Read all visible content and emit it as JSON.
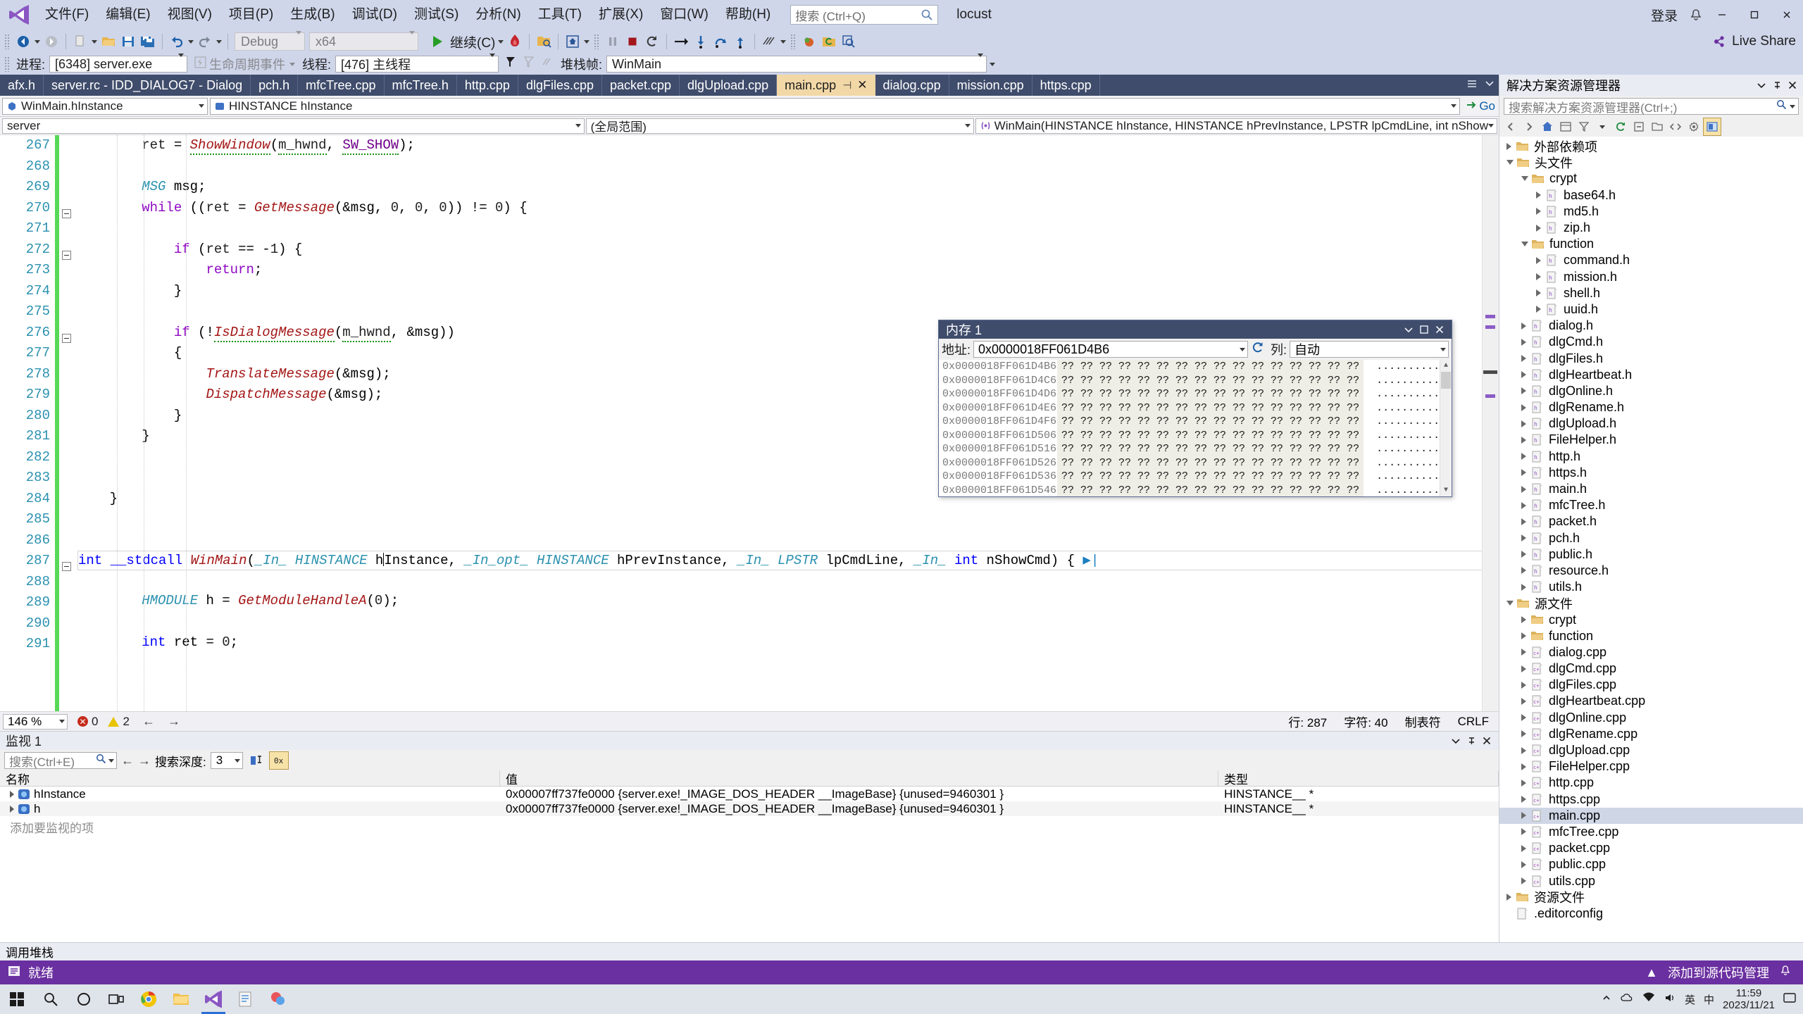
{
  "menubar": {
    "items": [
      "文件(F)",
      "编辑(E)",
      "视图(V)",
      "项目(P)",
      "生成(B)",
      "调试(D)",
      "测试(S)",
      "分析(N)",
      "工具(T)",
      "扩展(X)",
      "窗口(W)",
      "帮助(H)"
    ],
    "search_placeholder": "搜索 (Ctrl+Q)",
    "project_name": "locust",
    "signin_label": "登录",
    "minimize": "—",
    "maximize": "▢",
    "close": "✕"
  },
  "toolbar": {
    "nav_back": "back-arrow",
    "nav_forward": "forward-arrow",
    "new_item": "new-item",
    "open_file": "open-file",
    "save": "save",
    "save_all": "save-all",
    "undo": "undo",
    "redo": "redo",
    "config": "Debug",
    "platform": "x64",
    "continue_label": "继续(C)",
    "hotreload": "hot-reload",
    "attach": "attach-to-process",
    "stop_label": "stop",
    "restart_label": "restart",
    "step_over": "step-over",
    "step_into": "step-into",
    "step_out": "step-out",
    "live_share": "Live Share"
  },
  "debugbar": {
    "process_label": "进程:",
    "process_value": "[6348] server.exe",
    "lifecycle_label": "生命周期事件",
    "thread_label": "线程:",
    "thread_value": "[476] 主线程",
    "stackframe_label": "堆栈帧:",
    "stackframe_value": "WinMain"
  },
  "tabs": {
    "items": [
      {
        "label": "afx.h",
        "active": false
      },
      {
        "label": "server.rc - IDD_DIALOG7 - Dialog",
        "active": false
      },
      {
        "label": "pch.h",
        "active": false
      },
      {
        "label": "mfcTree.cpp",
        "active": false
      },
      {
        "label": "mfcTree.h",
        "active": false
      },
      {
        "label": "http.cpp",
        "active": false
      },
      {
        "label": "dlgFiles.cpp",
        "active": false
      },
      {
        "label": "packet.cpp",
        "active": false
      },
      {
        "label": "dlgUpload.cpp",
        "active": false
      },
      {
        "label": "main.cpp",
        "active": true
      },
      {
        "label": "dialog.cpp",
        "active": false
      },
      {
        "label": "mission.cpp",
        "active": false
      },
      {
        "label": "https.cpp",
        "active": false
      }
    ],
    "pin_glyph": "⊣",
    "close_glyph": "✕"
  },
  "navbar": {
    "class_value": "WinMain.hInstance",
    "member_value": "HINSTANCE hInstance",
    "go_label": "Go"
  },
  "scopebar": {
    "project_value": "server",
    "scope_value": "(全局范围)",
    "function_value": "WinMain(HINSTANCE hInstance, HINSTANCE hPrevInstance, LPSTR lpCmdLine, int nShow"
  },
  "editor": {
    "first_line": 267,
    "lines": [
      {
        "n": 267,
        "html": "        <i>ret</i> = <f u>ShowWindow</f>(<i u>m_hwnd</i>, <m u>SW_SHOW</m>);",
        "fold": false
      },
      {
        "n": 268,
        "html": "",
        "fold": false
      },
      {
        "n": 269,
        "html": "        <t>MSG</t> msg;",
        "fold": false
      },
      {
        "n": 270,
        "html": "        <c>while</c> ((<i>ret</i> = <f>GetMessage</f>(&amp;msg, <n>0</n>, <n>0</n>, <n>0</n>)) != <n>0</n>) {",
        "fold": true
      },
      {
        "n": 271,
        "html": "",
        "fold": false
      },
      {
        "n": 272,
        "html": "            <c>if</c> (<i>ret</i> == -<n>1</n>) {",
        "fold": true
      },
      {
        "n": 273,
        "html": "                <c>return</c>;",
        "fold": false
      },
      {
        "n": 274,
        "html": "            }",
        "fold": false
      },
      {
        "n": 275,
        "html": "",
        "fold": false
      },
      {
        "n": 276,
        "html": "            <c>if</c> (!<f u>IsDialogMessage</f>(<i u>m_hwnd</i>, &amp;msg))",
        "fold": true
      },
      {
        "n": 277,
        "html": "            {",
        "fold": false
      },
      {
        "n": 278,
        "html": "                <f>TranslateMessage</f>(&amp;msg);",
        "fold": false
      },
      {
        "n": 279,
        "html": "                <f>DispatchMessage</f>(&amp;msg);",
        "fold": false
      },
      {
        "n": 280,
        "html": "            }",
        "fold": false
      },
      {
        "n": 281,
        "html": "        }",
        "fold": false
      },
      {
        "n": 282,
        "html": "",
        "fold": false
      },
      {
        "n": 283,
        "html": "",
        "fold": false
      },
      {
        "n": 284,
        "html": "    }",
        "fold": false
      },
      {
        "n": 285,
        "html": "",
        "fold": false
      },
      {
        "n": 286,
        "html": "",
        "fold": false
      },
      {
        "n": 287,
        "html": "CURRENT",
        "fold": true
      },
      {
        "n": 288,
        "html": "",
        "fold": false
      },
      {
        "n": 289,
        "html": "        <t>HMODULE</t> h = <f>GetModuleHandleA</f>(<n>0</n>);",
        "fold": false
      },
      {
        "n": 290,
        "html": "",
        "fold": false
      },
      {
        "n": 291,
        "html": "        <k>int</k> ret = <n>0</n>;",
        "fold": false
      }
    ],
    "current_line_text": "int __stdcall WinMain(_In_ HINSTANCE hInstance, _In_opt_ HINSTANCE hPrevInstance, _In_ LPSTR lpCmdLine, _In_ int nShowCmd) {"
  },
  "editstatus": {
    "zoom": "146 %",
    "error_count": "0",
    "warning_count": "2",
    "line_label": "行: 287",
    "col_label": "字符: 40",
    "insert_label": "制表符",
    "eol_label": "CRLF"
  },
  "memory_window": {
    "title": "内存 1",
    "address_label": "地址:",
    "address_value": "0x0000018FF061D4B6",
    "refresh_icon": "refresh-icon",
    "columns_label": "列:",
    "columns_value": "自动",
    "hex_pattern": "?? ?? ?? ?? ?? ?? ?? ?? ?? ?? ?? ?? ?? ?? ?? ??",
    "ascii_pattern": "................",
    "rows": [
      "0x0000018FF061D4B6",
      "0x0000018FF061D4C6",
      "0x0000018FF061D4D6",
      "0x0000018FF061D4E6",
      "0x0000018FF061D4F6",
      "0x0000018FF061D506",
      "0x0000018FF061D516",
      "0x0000018FF061D526",
      "0x0000018FF061D536",
      "0x0000018FF061D546"
    ]
  },
  "watch_window": {
    "title": "监视 1",
    "search_placeholder": "搜索(Ctrl+E)",
    "depth_label": "搜索深度:",
    "depth_value": "3",
    "columns": [
      "名称",
      "值",
      "类型"
    ],
    "rows": [
      {
        "name": "hInstance",
        "value": "0x00007ff737fe0000 {server.exe!_IMAGE_DOS_HEADER __ImageBase} {unused=9460301 }",
        "type": "HINSTANCE__ *"
      },
      {
        "name": "h",
        "value": "0x00007ff737fe0000 {server.exe!_IMAGE_DOS_HEADER __ImageBase} {unused=9460301 }",
        "type": "HINSTANCE__ *"
      }
    ],
    "placeholder_row": "添加要监视的项"
  },
  "solution_explorer": {
    "title": "解决方案资源管理器",
    "search_placeholder": "搜索解决方案资源管理器(Ctrl+;)",
    "tree": [
      {
        "depth": 0,
        "label": "外部依赖项",
        "icon": "folder",
        "arrow": "closed"
      },
      {
        "depth": 0,
        "label": "头文件",
        "icon": "folder",
        "arrow": "open"
      },
      {
        "depth": 1,
        "label": "crypt",
        "icon": "folder",
        "arrow": "open"
      },
      {
        "depth": 2,
        "label": "base64.h",
        "icon": "header",
        "arrow": "closed"
      },
      {
        "depth": 2,
        "label": "md5.h",
        "icon": "header",
        "arrow": "closed"
      },
      {
        "depth": 2,
        "label": "zip.h",
        "icon": "header",
        "arrow": "closed"
      },
      {
        "depth": 1,
        "label": "function",
        "icon": "folder",
        "arrow": "open"
      },
      {
        "depth": 2,
        "label": "command.h",
        "icon": "header",
        "arrow": "closed"
      },
      {
        "depth": 2,
        "label": "mission.h",
        "icon": "header",
        "arrow": "closed"
      },
      {
        "depth": 2,
        "label": "shell.h",
        "icon": "header",
        "arrow": "closed"
      },
      {
        "depth": 2,
        "label": "uuid.h",
        "icon": "header",
        "arrow": "closed"
      },
      {
        "depth": 1,
        "label": "dialog.h",
        "icon": "header",
        "arrow": "closed"
      },
      {
        "depth": 1,
        "label": "dlgCmd.h",
        "icon": "header",
        "arrow": "closed"
      },
      {
        "depth": 1,
        "label": "dlgFiles.h",
        "icon": "header",
        "arrow": "closed"
      },
      {
        "depth": 1,
        "label": "dlgHeartbeat.h",
        "icon": "header",
        "arrow": "closed"
      },
      {
        "depth": 1,
        "label": "dlgOnline.h",
        "icon": "header",
        "arrow": "closed"
      },
      {
        "depth": 1,
        "label": "dlgRename.h",
        "icon": "header",
        "arrow": "closed"
      },
      {
        "depth": 1,
        "label": "dlgUpload.h",
        "icon": "header",
        "arrow": "closed"
      },
      {
        "depth": 1,
        "label": "FileHelper.h",
        "icon": "header",
        "arrow": "closed"
      },
      {
        "depth": 1,
        "label": "http.h",
        "icon": "header",
        "arrow": "closed"
      },
      {
        "depth": 1,
        "label": "https.h",
        "icon": "header",
        "arrow": "closed"
      },
      {
        "depth": 1,
        "label": "main.h",
        "icon": "header",
        "arrow": "closed"
      },
      {
        "depth": 1,
        "label": "mfcTree.h",
        "icon": "header",
        "arrow": "closed"
      },
      {
        "depth": 1,
        "label": "packet.h",
        "icon": "header",
        "arrow": "closed"
      },
      {
        "depth": 1,
        "label": "pch.h",
        "icon": "header",
        "arrow": "closed"
      },
      {
        "depth": 1,
        "label": "public.h",
        "icon": "header",
        "arrow": "closed"
      },
      {
        "depth": 1,
        "label": "resource.h",
        "icon": "header",
        "arrow": "closed"
      },
      {
        "depth": 1,
        "label": "utils.h",
        "icon": "header",
        "arrow": "closed"
      },
      {
        "depth": 0,
        "label": "源文件",
        "icon": "folder",
        "arrow": "open"
      },
      {
        "depth": 1,
        "label": "crypt",
        "icon": "folder",
        "arrow": "closed"
      },
      {
        "depth": 1,
        "label": "function",
        "icon": "folder",
        "arrow": "closed"
      },
      {
        "depth": 1,
        "label": "dialog.cpp",
        "icon": "cpp",
        "arrow": "closed"
      },
      {
        "depth": 1,
        "label": "dlgCmd.cpp",
        "icon": "cpp",
        "arrow": "closed"
      },
      {
        "depth": 1,
        "label": "dlgFiles.cpp",
        "icon": "cpp",
        "arrow": "closed"
      },
      {
        "depth": 1,
        "label": "dlgHeartbeat.cpp",
        "icon": "cpp",
        "arrow": "closed"
      },
      {
        "depth": 1,
        "label": "dlgOnline.cpp",
        "icon": "cpp",
        "arrow": "closed"
      },
      {
        "depth": 1,
        "label": "dlgRename.cpp",
        "icon": "cpp",
        "arrow": "closed"
      },
      {
        "depth": 1,
        "label": "dlgUpload.cpp",
        "icon": "cpp",
        "arrow": "closed"
      },
      {
        "depth": 1,
        "label": "FileHelper.cpp",
        "icon": "cpp",
        "arrow": "closed"
      },
      {
        "depth": 1,
        "label": "http.cpp",
        "icon": "cpp",
        "arrow": "closed"
      },
      {
        "depth": 1,
        "label": "https.cpp",
        "icon": "cpp",
        "arrow": "closed"
      },
      {
        "depth": 1,
        "label": "main.cpp",
        "icon": "cpp",
        "arrow": "closed",
        "selected": true
      },
      {
        "depth": 1,
        "label": "mfcTree.cpp",
        "icon": "cpp",
        "arrow": "closed"
      },
      {
        "depth": 1,
        "label": "packet.cpp",
        "icon": "cpp",
        "arrow": "closed"
      },
      {
        "depth": 1,
        "label": "public.cpp",
        "icon": "cpp",
        "arrow": "closed"
      },
      {
        "depth": 1,
        "label": "utils.cpp",
        "icon": "cpp",
        "arrow": "closed"
      },
      {
        "depth": 0,
        "label": "资源文件",
        "icon": "folder",
        "arrow": "closed"
      },
      {
        "depth": 0,
        "label": ".editorconfig",
        "icon": "file",
        "arrow": "blank"
      }
    ]
  },
  "bottom": {
    "call_stack_label": "调用堆栈",
    "status_ready": "就绪",
    "status_source_control": "添加到源代码管理",
    "status_arrow": "▲"
  },
  "taskbar": {
    "start": "start-icon",
    "search": "搜索",
    "cortana": "cortana-icon",
    "taskview": "task-view-icon",
    "chrome": "chrome-icon",
    "explorer": "file-explorer-icon",
    "vs": "visual-studio-icon",
    "notes": "notes-icon",
    "paint": "paint-icon",
    "lang": "英",
    "ime": "中",
    "time": "11:59",
    "date": "2023/11/21"
  },
  "colors": {
    "accent": "#3f4c6b",
    "status": "#6a2fa0",
    "active_tab": "#f2d8a7",
    "changebar": "#57d957"
  }
}
